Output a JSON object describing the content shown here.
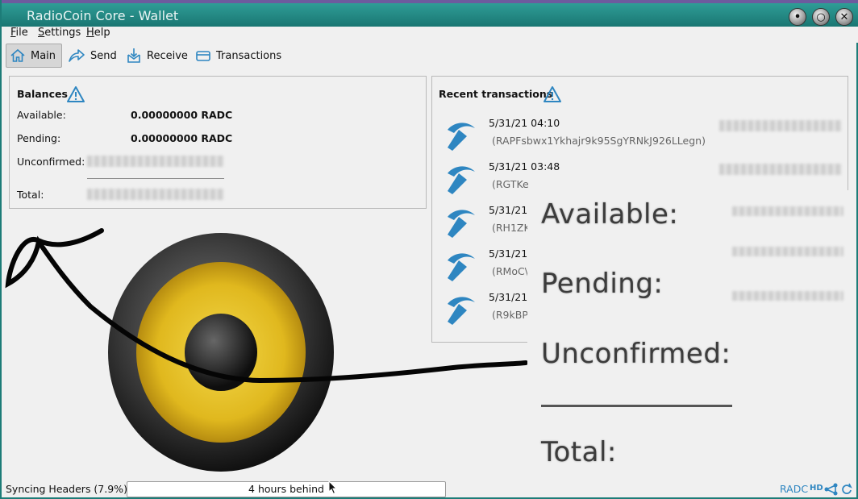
{
  "window": {
    "title": "RadioCoin Core - Wallet"
  },
  "menu": {
    "file": "File",
    "settings": "Settings",
    "help": "Help",
    "file_u": "F",
    "file_rest": "ile",
    "settings_u": "S",
    "settings_rest": "ettings",
    "help_u": "H",
    "help_rest": "elp"
  },
  "toolbar": {
    "main": "Main",
    "send": "Send",
    "receive": "Receive",
    "transactions": "Transactions"
  },
  "balances": {
    "heading": "Balances",
    "available_label": "Available:",
    "available_value": "0.00000000 RADC",
    "pending_label": "Pending:",
    "pending_value": "0.00000000 RADC",
    "unconfirmed_label": "Unconfirmed:",
    "total_label": "Total:"
  },
  "recent": {
    "heading": "Recent transactions",
    "items": [
      {
        "date": "5/31/21 04:10",
        "address": "(RAPFsbwx1Ykhajr9k95SgYRNkJ926LLegn)"
      },
      {
        "date": "5/31/21 03:48",
        "address": "(RGTKe"
      },
      {
        "date": "5/31/21",
        "address": "(RH1ZK"
      },
      {
        "date": "5/31/21",
        "address": "(RMoC\\"
      },
      {
        "date": "5/31/21",
        "address": "(R9kBP"
      }
    ]
  },
  "overlay": {
    "available": "Available:",
    "pending": "Pending:",
    "unconfirmed": "Unconfirmed:",
    "total": "Total:"
  },
  "status": {
    "syncing": "Syncing Headers (7.9%)...",
    "progress_text": "4 hours behind",
    "unit": "RADC",
    "hd": "HD"
  },
  "colors": {
    "titlebar": "#1d7c78",
    "icon_blue": "#2e86c1",
    "speaker_yellow": "#e6c22a"
  }
}
